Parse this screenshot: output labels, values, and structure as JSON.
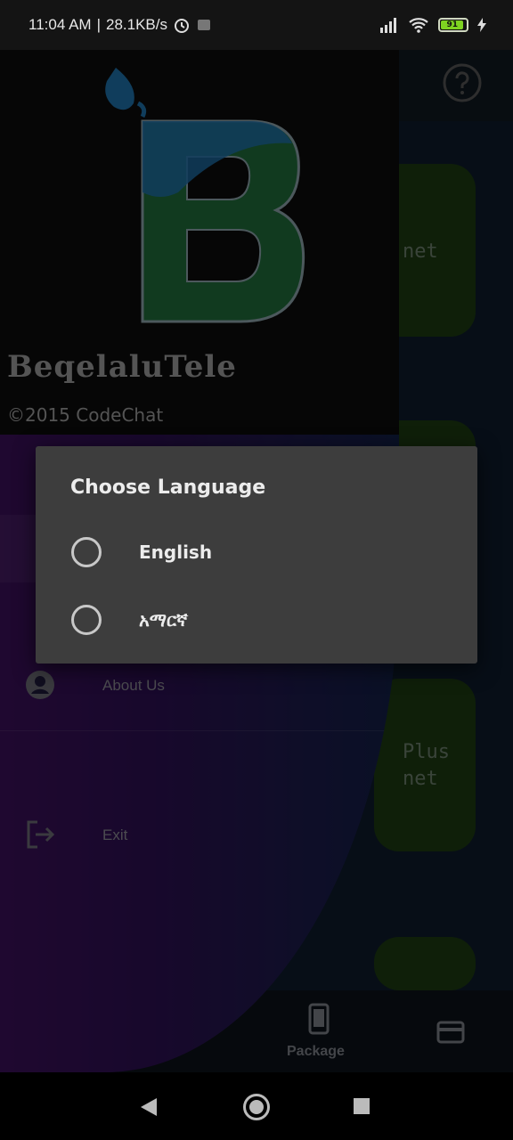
{
  "status_bar": {
    "time": "11:04 AM",
    "speed": "28.1KB/s",
    "battery": "91"
  },
  "background_app": {
    "card_texts": [
      "net",
      "Plus",
      "net"
    ],
    "bottom_nav": {
      "package_label": "Package"
    }
  },
  "drawer": {
    "app_name": "BeqelaluTele",
    "copyright": "©2015 CodeChat",
    "items": [
      {
        "label": "About Us",
        "icon": "account-circle-icon"
      },
      {
        "label": "Exit",
        "icon": "exit-icon"
      }
    ]
  },
  "dialog": {
    "title": "Choose Language",
    "options": [
      {
        "label": "English",
        "selected": false
      },
      {
        "label": "አማርኛ",
        "selected": false
      }
    ]
  },
  "colors": {
    "dialog_bg": "#3d3d3d",
    "drawer_gradient_start": "#3a0f58",
    "logo_green": "#1f6b3a",
    "logo_blue": "#1e6fa8"
  }
}
